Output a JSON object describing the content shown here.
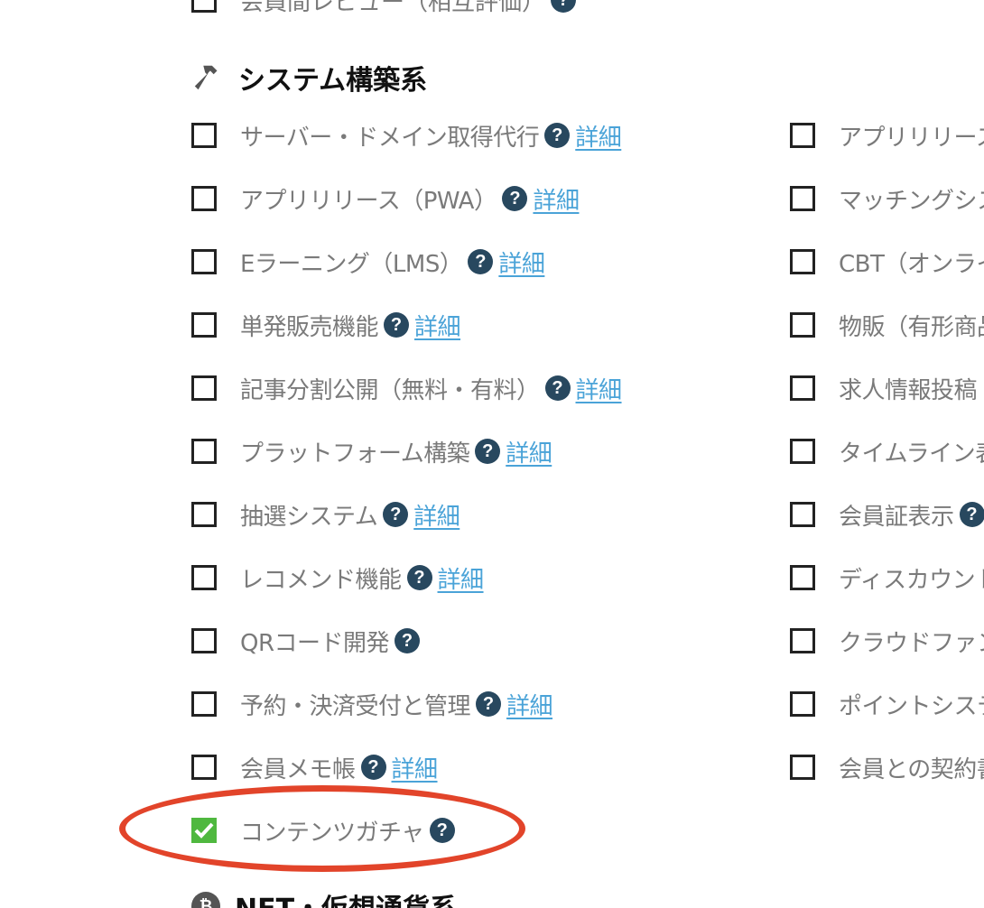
{
  "previous_item": {
    "label": "会員間レビュー（相互評価）"
  },
  "section": {
    "title": "システム構築系",
    "icon": "hammer-icon"
  },
  "next_section": {
    "title": "NFT・仮想通貨系",
    "icon": "coin-icon"
  },
  "help_glyph": "?",
  "left_column": [
    {
      "label": "サーバー・ドメイン取得代行",
      "checked": false,
      "has_help": true,
      "link": "詳細"
    },
    {
      "label": "アプリリリース（PWA）",
      "checked": false,
      "has_help": true,
      "link": "詳細"
    },
    {
      "label": "Eラーニング（LMS）",
      "checked": false,
      "has_help": true,
      "link": "詳細"
    },
    {
      "label": "単発販売機能",
      "checked": false,
      "has_help": true,
      "link": "詳細"
    },
    {
      "label": "記事分割公開（無料・有料）",
      "checked": false,
      "has_help": true,
      "link": "詳細"
    },
    {
      "label": "プラットフォーム構築",
      "checked": false,
      "has_help": true,
      "link": "詳細"
    },
    {
      "label": "抽選システム",
      "checked": false,
      "has_help": true,
      "link": "詳細"
    },
    {
      "label": "レコメンド機能",
      "checked": false,
      "has_help": true,
      "link": "詳細"
    },
    {
      "label": "QRコード開発",
      "checked": false,
      "has_help": true,
      "link": ""
    },
    {
      "label": "予約・決済受付と管理",
      "checked": false,
      "has_help": true,
      "link": "詳細"
    },
    {
      "label": "会員メモ帳",
      "checked": false,
      "has_help": true,
      "link": "詳細"
    },
    {
      "label": "コンテンツガチャ",
      "checked": true,
      "has_help": true,
      "link": ""
    }
  ],
  "right_column": [
    {
      "label": "アプリリリース"
    },
    {
      "label": "マッチングシス"
    },
    {
      "label": "CBT（オンライ"
    },
    {
      "label": "物販（有形商品"
    },
    {
      "label": "求人情報投稿"
    },
    {
      "label": "タイムライン表"
    },
    {
      "label": "会員証表示",
      "has_help": true
    },
    {
      "label": "ディスカウント"
    },
    {
      "label": "クラウドファン"
    },
    {
      "label": "ポイントシステ"
    },
    {
      "label": "会員との契約書"
    }
  ],
  "colors": {
    "checkbox_border": "#222222",
    "checked_fill": "#4fb83f",
    "help_badge": "#28485f",
    "link": "#4aa3d8",
    "label_text": "#7a7a7a",
    "highlight_oval": "#e2442a"
  }
}
